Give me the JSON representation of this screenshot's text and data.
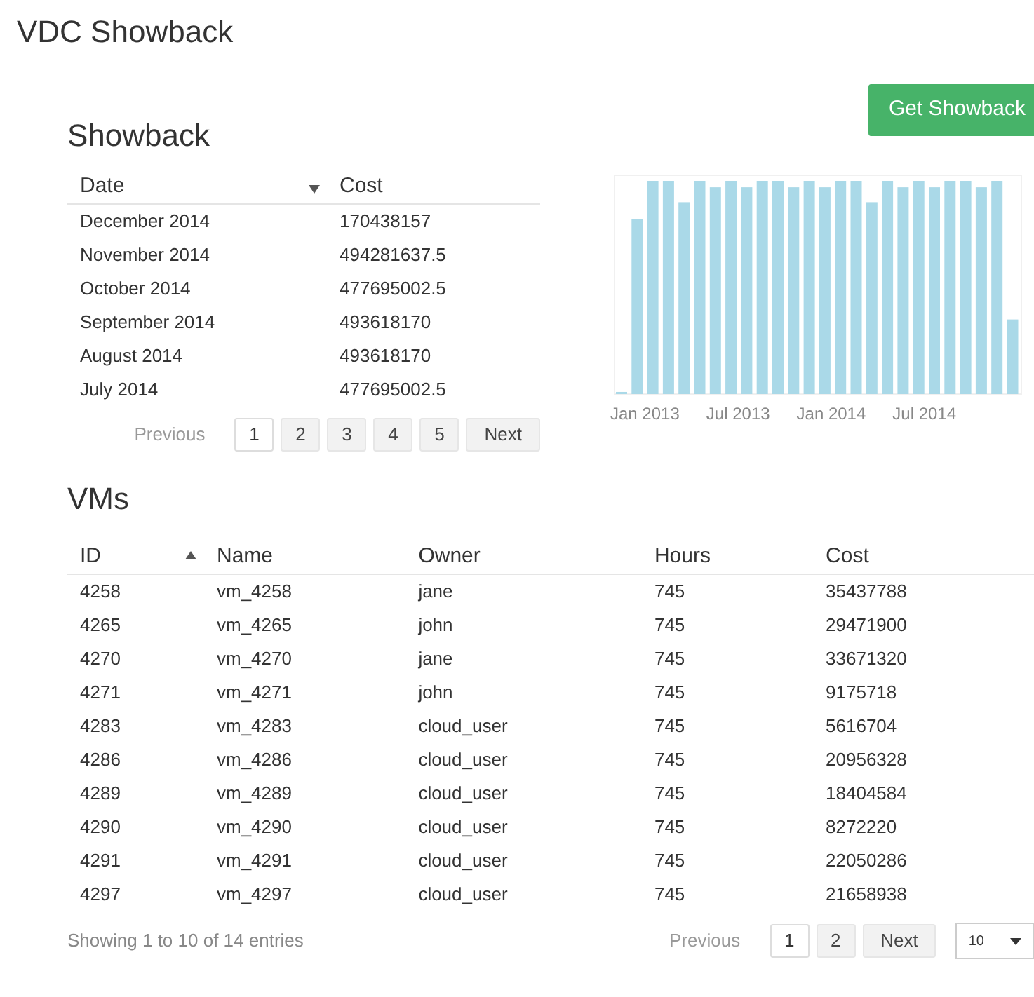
{
  "page_title": "VDC Showback",
  "get_button": "Get Showback",
  "showback": {
    "heading": "Showback",
    "columns": [
      {
        "label": "Date",
        "sorted": true,
        "descending": true
      },
      {
        "label": "Cost",
        "sorted": false
      }
    ],
    "rows": [
      [
        "December 2014",
        "170438157"
      ],
      [
        "November 2014",
        "494281637.5"
      ],
      [
        "October 2014",
        "477695002.5"
      ],
      [
        "September 2014",
        "493618170"
      ],
      [
        "August 2014",
        "493618170"
      ],
      [
        "July 2014",
        "477695002.5"
      ]
    ],
    "pagination": {
      "previous": "Previous",
      "pages": [
        {
          "label": "1",
          "selected": true
        },
        {
          "label": "2",
          "selected": false
        },
        {
          "label": "3",
          "selected": false
        },
        {
          "label": "4",
          "selected": false
        },
        {
          "label": "5",
          "selected": false
        }
      ],
      "next": "Next"
    },
    "chart_axis_labels": [
      "Jan 2013",
      "Jul 2013",
      "Jan 2014",
      "Jul 2014"
    ]
  },
  "vms": {
    "heading": "VMs",
    "columns": [
      {
        "label": "ID",
        "sorted": true,
        "descending": false
      },
      {
        "label": "Name",
        "sorted": false
      },
      {
        "label": "Owner",
        "sorted": false
      },
      {
        "label": "Hours",
        "sorted": false
      },
      {
        "label": "Cost",
        "sorted": false
      }
    ],
    "rows": [
      [
        "4258",
        "vm_4258",
        "jane",
        "745",
        "35437788"
      ],
      [
        "4265",
        "vm_4265",
        "john",
        "745",
        "29471900"
      ],
      [
        "4270",
        "vm_4270",
        "jane",
        "745",
        "33671320"
      ],
      [
        "4271",
        "vm_4271",
        "john",
        "745",
        "9175718"
      ],
      [
        "4283",
        "vm_4283",
        "cloud_user",
        "745",
        "5616704"
      ],
      [
        "4286",
        "vm_4286",
        "cloud_user",
        "745",
        "20956328"
      ],
      [
        "4289",
        "vm_4289",
        "cloud_user",
        "745",
        "18404584"
      ],
      [
        "4290",
        "vm_4290",
        "cloud_user",
        "745",
        "8272220"
      ],
      [
        "4291",
        "vm_4291",
        "cloud_user",
        "745",
        "22050286"
      ],
      [
        "4297",
        "vm_4297",
        "cloud_user",
        "745",
        "21658938"
      ]
    ],
    "info": "Showing 1 to 10 of 14 entries",
    "pagination": {
      "previous": "Previous",
      "pages": [
        {
          "label": "1",
          "selected": true
        },
        {
          "label": "2",
          "selected": false
        }
      ],
      "next": "Next"
    },
    "page_size": "10"
  }
}
